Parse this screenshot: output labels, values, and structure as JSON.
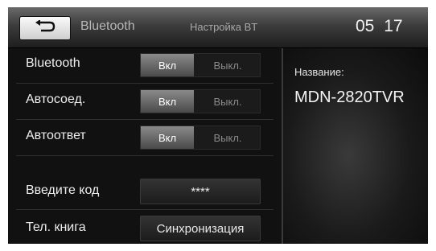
{
  "header": {
    "back_icon": "back-arrow-icon",
    "title": "Bluetooth",
    "subtitle": "Настройка BT",
    "clock": "05 17"
  },
  "settings": {
    "rows": [
      {
        "label": "Bluetooth",
        "on_label": "Вкл",
        "off_label": "Выкл.",
        "selected": "on"
      },
      {
        "label": "Автосоед.",
        "on_label": "Вкл",
        "off_label": "Выкл.",
        "selected": "on"
      },
      {
        "label": "Автоответ",
        "on_label": "Вкл",
        "off_label": "Выкл.",
        "selected": "on"
      }
    ],
    "code": {
      "label": "Введите код",
      "value": "****"
    },
    "phonebook": {
      "label": "Тел. книга",
      "button": "Синхронизация"
    }
  },
  "device": {
    "name_label": "Название:",
    "name_value": "MDN-2820TVR"
  }
}
